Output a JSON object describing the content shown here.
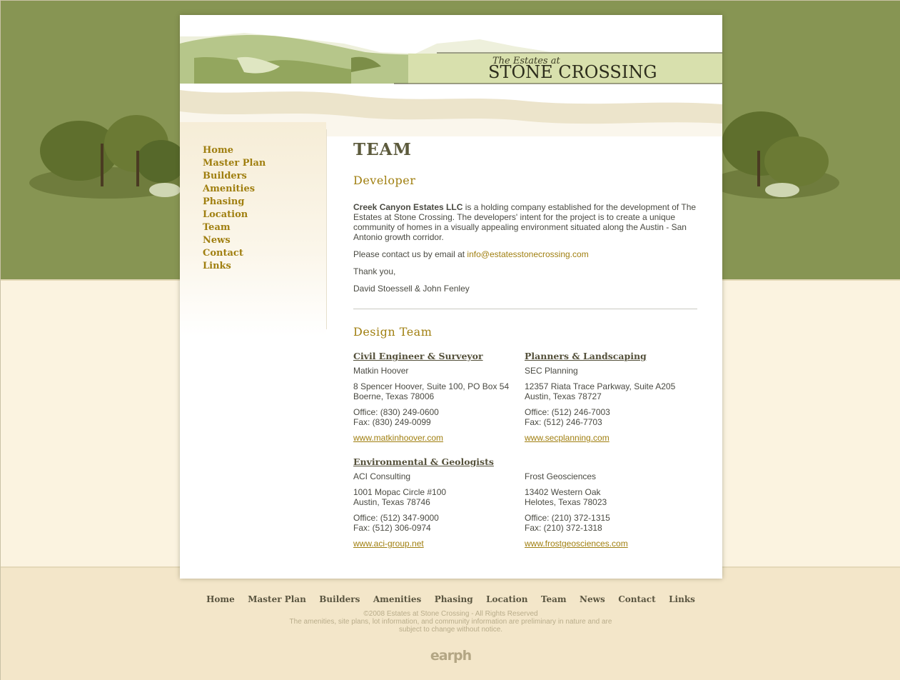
{
  "site": {
    "logo_top": "The Estates at",
    "logo_main": "STONE CROSSING"
  },
  "nav": [
    "Home",
    "Master Plan",
    "Builders",
    "Amenities",
    "Phasing",
    "Location",
    "Team",
    "News",
    "Contact",
    "Links"
  ],
  "page": {
    "title": "TEAM",
    "developer": {
      "heading": "Developer",
      "company": "Creek Canyon Estates LLC",
      "desc": " is a holding company established for the development of The Estates at Stone Crossing.  The developers' intent for the project is to create a unique community of homes in a visually appealing environment situated along the Austin - San Antonio growth corridor.",
      "contact_prefix": "Please contact us by email at ",
      "email": "info@estatesstonecrossing.com",
      "thanks": "Thank you,",
      "signature": "David Stoessell & John Fenley"
    },
    "design_team": {
      "heading": "Design Team",
      "groups": [
        {
          "head": "Civil Engineer & Surveyor",
          "name": "Matkin Hoover",
          "addr1": "8 Spencer Hoover, Suite 100, PO Box 54",
          "addr2": "Boerne, Texas 78006",
          "office": "Office: (830) 249-0600",
          "fax": "Fax: (830) 249-0099",
          "web": "www.matkinhoover.com"
        },
        {
          "head": "Planners & Landscaping",
          "name": "SEC Planning",
          "addr1": "12357 Riata Trace Parkway, Suite A205",
          "addr2": "Austin, Texas 78727",
          "office": "Office: (512) 246-7003",
          "fax": "Fax: (512) 246-7703",
          "web": "www.secplanning.com"
        },
        {
          "head": "Environmental & Geologists",
          "name": "ACI Consulting",
          "addr1": "1001 Mopac Circle #100",
          "addr2": "Austin, Texas 78746",
          "office": "Office: (512) 347-9000",
          "fax": "Fax: (512) 306-0974",
          "web": "www.aci-group.net"
        },
        {
          "head": "",
          "name": "Frost Geosciences",
          "addr1": "13402 Western Oak",
          "addr2": "Helotes, Texas 78023",
          "office": "Office: (210) 372-1315",
          "fax": "Fax: (210) 372-1318",
          "web": "www.frostgeosciences.com"
        }
      ]
    }
  },
  "footer": {
    "copyright": "©2008 Estates at Stone Crossing - All Rights Reserved",
    "disclaimer1": "The amenities, site plans, lot information, and community information are preliminary in nature and are",
    "disclaimer2": "subject to change without notice.",
    "credit": "earph"
  },
  "colors": {
    "accent": "#a07f10",
    "green_bg": "#879553",
    "cream_bg": "#fbf3e0",
    "footer_bg": "#f3e6c9"
  }
}
